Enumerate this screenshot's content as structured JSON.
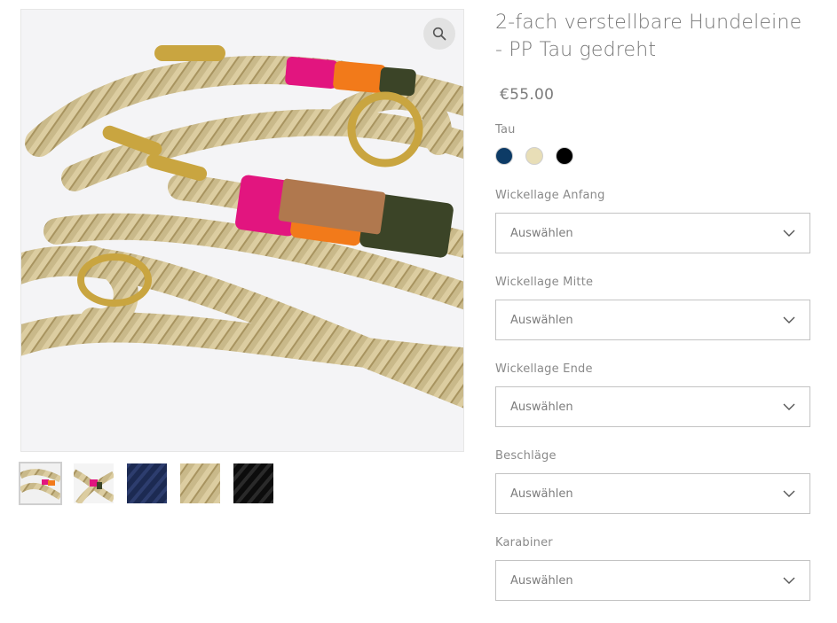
{
  "product": {
    "title": "2-fach verstellbare Hundeleine - PP Tau gedreht",
    "price": "€55.00"
  },
  "gallery": {
    "zoom_icon": "magnifier-icon",
    "thumbnails": [
      "beige rope leash",
      "pink-orange wrapped leash",
      "navy rope",
      "beige rope",
      "black rope"
    ]
  },
  "options": {
    "color_label": "Tau",
    "swatch_colors": [
      "#0d3b66",
      "#e8deb7",
      "#000000"
    ],
    "selects": [
      {
        "label": "Wickellage Anfang",
        "value": "Auswählen"
      },
      {
        "label": "Wickellage Mitte",
        "value": "Auswählen"
      },
      {
        "label": "Wickellage Ende",
        "value": "Auswählen"
      },
      {
        "label": "Beschläge",
        "value": "Auswählen"
      },
      {
        "label": "Karabiner",
        "value": "Auswählen"
      }
    ]
  }
}
